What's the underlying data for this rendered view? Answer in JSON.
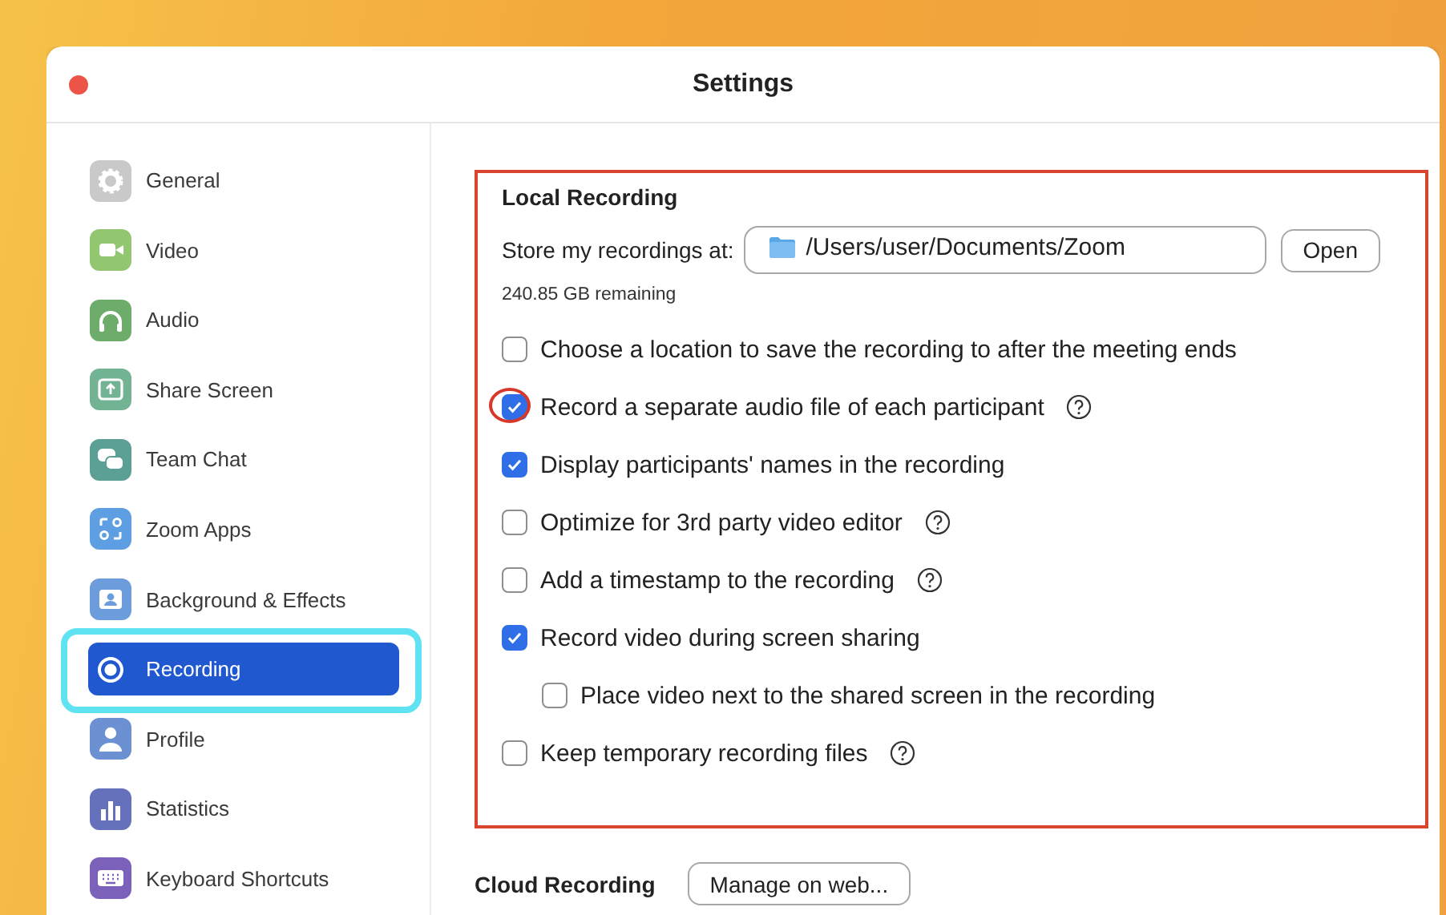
{
  "window": {
    "title": "Settings"
  },
  "sidebar": {
    "items": [
      {
        "label": "General",
        "selected": false,
        "highlighted": false
      },
      {
        "label": "Video",
        "selected": false,
        "highlighted": false
      },
      {
        "label": "Audio",
        "selected": false,
        "highlighted": false
      },
      {
        "label": "Share Screen",
        "selected": false,
        "highlighted": false
      },
      {
        "label": "Team Chat",
        "selected": false,
        "highlighted": false
      },
      {
        "label": "Zoom Apps",
        "selected": false,
        "highlighted": false
      },
      {
        "label": "Background & Effects",
        "selected": false,
        "highlighted": false
      },
      {
        "label": "Recording",
        "selected": true,
        "highlighted": true
      },
      {
        "label": "Profile",
        "selected": false,
        "highlighted": false
      },
      {
        "label": "Statistics",
        "selected": false,
        "highlighted": false
      },
      {
        "label": "Keyboard Shortcuts",
        "selected": false,
        "highlighted": false
      }
    ]
  },
  "local_recording": {
    "title": "Local Recording",
    "outlined": true,
    "store_label": "Store my recordings at:",
    "path": "/Users/user/Documents/Zoom",
    "open_button": "Open",
    "remaining": "240.85 GB remaining",
    "options": [
      {
        "label": "Choose a location to save the recording to after the meeting ends",
        "checked": false,
        "help": false,
        "circled": false
      },
      {
        "label": "Record a separate audio file of each participant",
        "checked": true,
        "help": true,
        "circled": true
      },
      {
        "label": "Display participants' names in the recording",
        "checked": true,
        "help": false,
        "circled": false
      },
      {
        "label": "Optimize for 3rd party video editor",
        "checked": false,
        "help": true,
        "circled": false
      },
      {
        "label": "Add a timestamp to the recording",
        "checked": false,
        "help": true,
        "circled": false
      },
      {
        "label": "Record video during screen sharing",
        "checked": true,
        "help": false,
        "circled": false,
        "children": [
          {
            "label": "Place video next to the shared screen in the recording",
            "checked": false,
            "help": false,
            "circled": false
          }
        ]
      },
      {
        "label": "Keep temporary recording files",
        "checked": false,
        "help": true,
        "circled": false
      }
    ]
  },
  "cloud_recording": {
    "title": "Cloud Recording",
    "button": "Manage on web..."
  }
}
